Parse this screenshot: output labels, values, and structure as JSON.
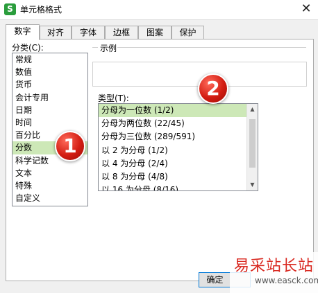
{
  "window": {
    "title": "单元格格式",
    "app_icon_glyph": "S",
    "close_glyph": "✕"
  },
  "tabs": [
    "数字",
    "对齐",
    "字体",
    "边框",
    "图案",
    "保护"
  ],
  "active_tab": "数字",
  "category": {
    "label": "分类(C):",
    "items": [
      "常规",
      "数值",
      "货币",
      "会计专用",
      "日期",
      "时间",
      "百分比",
      "分数",
      "科学记数",
      "文本",
      "特殊",
      "自定义"
    ],
    "selected": "分数"
  },
  "sample": {
    "label": "示例",
    "value": ""
  },
  "type": {
    "label": "类型(T):",
    "items": [
      "分母为一位数 (1/2)",
      "分母为两位数 (22/45)",
      "分母为三位数 (289/591)",
      "以 2 为分母 (1/2)",
      "以 4 为分母 (2/4)",
      "以 8 为分母 (4/8)",
      "以 16 为分母 (8/16)"
    ],
    "selected": "分母为一位数 (1/2)"
  },
  "annotations": {
    "badge_1": "1",
    "badge_2": "2"
  },
  "buttons": {
    "ok_label": "确定"
  },
  "watermark": {
    "logo_text": "易采站长站",
    "url": "www.easck.com"
  },
  "colors": {
    "selection": "#cde8b7",
    "badge_red": "#d31d12",
    "app_icon_green": "#2a9d3c",
    "focus_blue": "#0078d7"
  }
}
